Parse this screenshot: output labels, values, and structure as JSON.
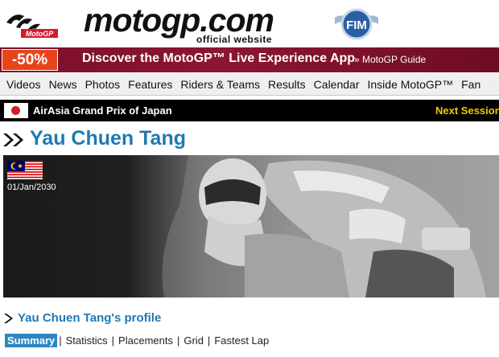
{
  "header": {
    "logo_text": "motogp.com",
    "logo_subtitle": "official website",
    "logo_mark_text": "MotoGP",
    "fim_text": "FIM"
  },
  "promo": {
    "badge": "-50%",
    "text": "Discover the MotoGP™ Live Experience App",
    "link": "» MotoGP Guide"
  },
  "nav": {
    "items": [
      "Videos",
      "News",
      "Photos",
      "Features",
      "Riders & Teams",
      "Results",
      "Calendar",
      "Inside MotoGP™",
      "Fan"
    ]
  },
  "event": {
    "name": "AirAsia Grand Prix of Japan",
    "next_session": "Next Session"
  },
  "rider": {
    "name": "Yau Chuen Tang",
    "dob": "01/Jan/2030",
    "flag": "malaysia-flag"
  },
  "profile": {
    "title": "Yau Chuen Tang's profile",
    "tabs": [
      "Summary",
      "Statistics",
      "Placements",
      "Grid",
      "Fastest Lap"
    ],
    "active_tab": "Summary"
  },
  "colors": {
    "accent_blue": "#1f79b5",
    "promo_bg": "#7a0f2a",
    "promo_badge": "#e8441a",
    "next_session": "#f5c800"
  }
}
